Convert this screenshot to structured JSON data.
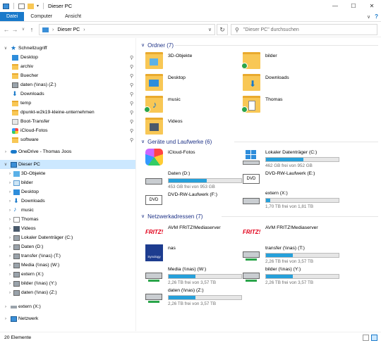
{
  "window": {
    "title": "Dieser PC"
  },
  "ribbon": {
    "tabs": [
      "Datei",
      "Computer",
      "Ansicht"
    ]
  },
  "address": {
    "path": "Dieser PC",
    "search_placeholder": "\"Dieser PC\" durchsuchen"
  },
  "sidebar": {
    "quick_access": "Schnellzugriff",
    "quick_items": [
      "Desktop",
      "archiv",
      "Buecher",
      "daten (\\\\nas) (Z:)",
      "Downloads",
      "temp",
      "dpunkt-w2k19-kleine-unternehmen",
      "Boot-Transfer",
      "iCloud-Fotos",
      "software"
    ],
    "onedrive": "OneDrive - Thomas Joos",
    "this_pc": "Dieser PC",
    "pc_items": [
      "3D-Objekte",
      "bilder",
      "Desktop",
      "Downloads",
      "music",
      "Thomas",
      "Videos",
      "Lokaler Datenträger (C:)",
      "Daten (D:)",
      "transfer (\\\\nas) (T:)",
      "Media (\\\\nas) (W:)",
      "extern (X:)",
      "bilder (\\\\nas) (Y:)",
      "daten (\\\\nas) (Z:)"
    ],
    "extern": "extern (X:)",
    "network": "Netzwerk"
  },
  "groups": {
    "folders": "Ordner (7)",
    "devices": "Geräte und Laufwerke (6)",
    "network": "Netzwerkadressen (7)"
  },
  "folders": [
    "3D-Objekte",
    "bilder",
    "Desktop",
    "Downloads",
    "music",
    "Thomas",
    "Videos"
  ],
  "devices": [
    {
      "name": "iCloud-Fotos",
      "free": "",
      "usage": null
    },
    {
      "name": "Lokaler Datenträger (C:)",
      "free": "462 GB frei von 952 GB",
      "usage": 0.51
    },
    {
      "name": "Daten (D:)",
      "free": "453 GB frei von 953 GB",
      "usage": 0.52
    },
    {
      "name": "DVD-RW-Laufwerk (E:)",
      "free": "",
      "usage": null
    },
    {
      "name": "DVD-RW-Laufwerk (F:)",
      "free": "",
      "usage": null
    },
    {
      "name": "extern (X:)",
      "free": "1,70 TB frei von 1,81 TB",
      "usage": 0.06
    }
  ],
  "network_items": [
    {
      "name": "AVM FRITZ!Mediaserver",
      "free": "",
      "usage": null
    },
    {
      "name": "AVM FRITZ!Mediaserver",
      "free": "",
      "usage": null
    },
    {
      "name": "nas",
      "free": "",
      "usage": null
    },
    {
      "name": "transfer (\\\\nas) (T:)",
      "free": "2,26 TB frei von 3,57 TB",
      "usage": 0.37
    },
    {
      "name": "Media (\\\\nas) (W:)",
      "free": "2,26 TB frei von 3,57 TB",
      "usage": 0.37
    },
    {
      "name": "bilder (\\\\nas) (Y:)",
      "free": "2,26 TB frei von 3,57 TB",
      "usage": 0.37
    },
    {
      "name": "daten (\\\\nas) (Z:)",
      "free": "2,26 TB frei von 3,57 TB",
      "usage": 0.37
    }
  ],
  "status": {
    "count": "20 Elemente"
  },
  "colors": {
    "accent": "#1979ca",
    "group_title": "#1e3287",
    "bar_fill": "#26a0da",
    "selected_bg": "#cce8ff"
  },
  "icon_logos": {
    "fritz": "FRITZ!",
    "synology": "Synology"
  }
}
